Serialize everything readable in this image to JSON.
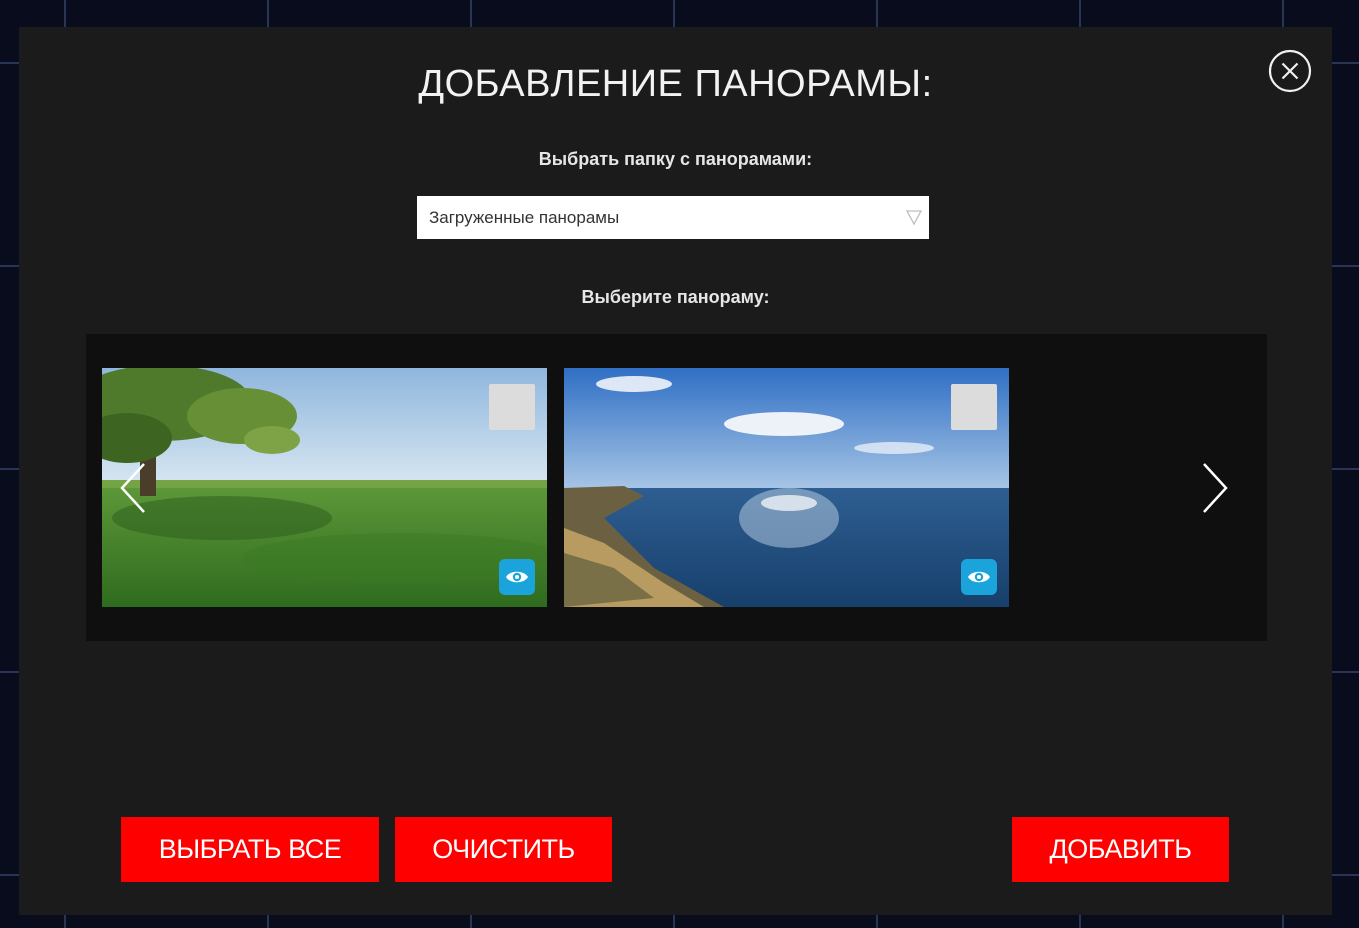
{
  "modal": {
    "title": "ДОБАВЛЕНИЕ ПАНОРАМЫ:",
    "close_icon": "close-circle-icon"
  },
  "folder": {
    "label": "Выбрать папку с панорамами:",
    "selected": "Загруженные панорамы",
    "arrow_icon": "triangle-down-icon"
  },
  "panorama": {
    "label": "Выберите панораму:",
    "items": [
      {
        "scene": "meadow-with-tree",
        "checked": false,
        "preview_icon": "eye-icon"
      },
      {
        "scene": "sea-coast",
        "checked": false,
        "preview_icon": "eye-icon"
      }
    ],
    "prev_icon": "chevron-left-icon",
    "next_icon": "chevron-right-icon"
  },
  "actions": {
    "select_all": "ВЫБРАТЬ ВСЕ",
    "clear": "ОЧИСТИТЬ",
    "add": "ДОБАВИТЬ"
  },
  "colors": {
    "accent": "#ff0000",
    "preview": "#1aa4db",
    "modal_bg": "#1b1b1b"
  }
}
